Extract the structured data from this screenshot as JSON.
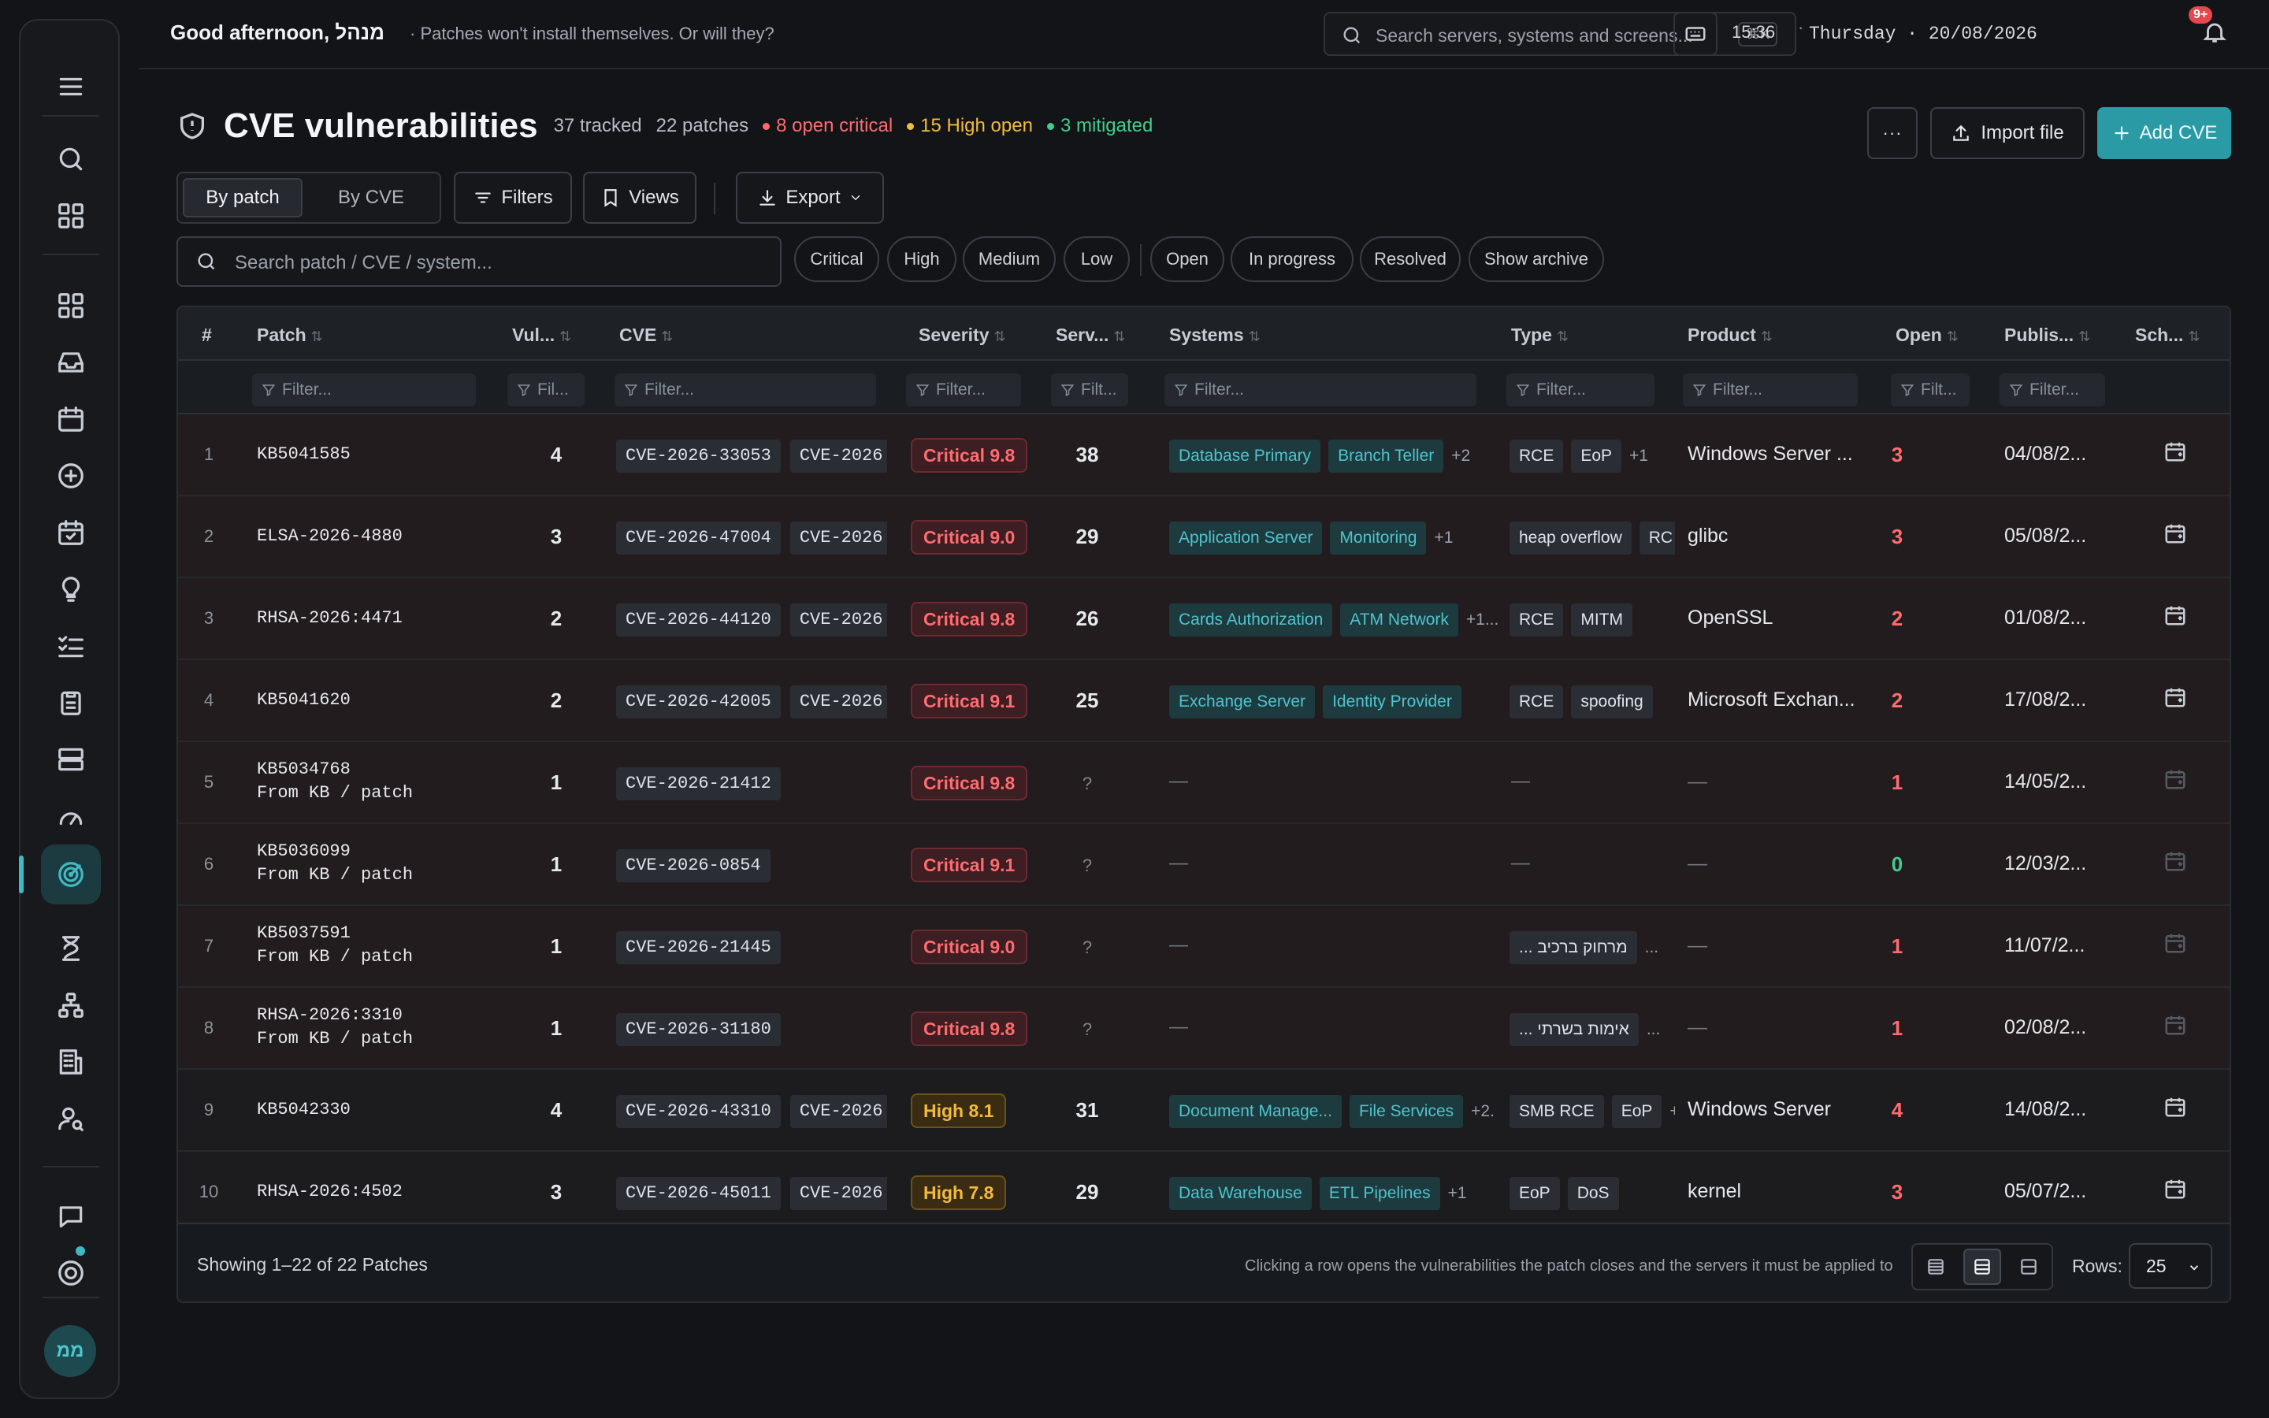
{
  "header": {
    "greeting": "Good afternoon, מנהל",
    "tagline": "· Patches won't install themselves. Or will they?",
    "search_placeholder": "Search servers, systems and screens...",
    "search_shortcut": "⌘K",
    "time": "15:36",
    "time_sep": "·",
    "date": "Thursday · 20/08/2026",
    "notifications_badge": "9+"
  },
  "page": {
    "title": "CVE vulnerabilities",
    "stats": {
      "tracked": "37 tracked",
      "patches": "22 patches",
      "open_critical": "8 open critical",
      "high_open": "15 High open",
      "mitigated": "3 mitigated"
    },
    "actions": {
      "more": "···",
      "import": "Import file",
      "add": "Add CVE"
    }
  },
  "toolbar": {
    "view_by_patch": "By patch",
    "view_by_cve": "By CVE",
    "filters": "Filters",
    "views": "Views",
    "export": "Export",
    "search_placeholder": "Search patch / CVE / system...",
    "chips": [
      "Critical",
      "High",
      "Medium",
      "Low",
      "Open",
      "In progress",
      "Resolved",
      "Show archive"
    ]
  },
  "table": {
    "columns": [
      "#",
      "Patch",
      "Vul...",
      "CVE",
      "Severity",
      "Serv...",
      "Systems",
      "Type",
      "Product",
      "Open",
      "Publis...",
      "Sch..."
    ],
    "filter_placeholders": [
      "Filter...",
      "Fil...",
      "Filter...",
      "Filter...",
      "Filt...",
      "Filter...",
      "Filter...",
      "Filter...",
      "Filt...",
      "Filter..."
    ],
    "rows": [
      {
        "n": "1",
        "patch": "KB5041585",
        "sub": "",
        "vul": "4",
        "cves": [
          "CVE-2026-33053",
          "CVE-2026"
        ],
        "sev": "Critical 9.8",
        "sev_level": "critical",
        "servers": "38",
        "systems": [
          "Database Primary",
          "Branch Teller"
        ],
        "systems_more": "+2",
        "types": [
          "RCE",
          "EoP"
        ],
        "types_more": "+1",
        "product": "Windows Server ...",
        "open": "3",
        "published": "04/08/2...",
        "sched_active": true
      },
      {
        "n": "2",
        "patch": "ELSA-2026-4880",
        "sub": "",
        "vul": "3",
        "cves": [
          "CVE-2026-47004",
          "CVE-2026"
        ],
        "sev": "Critical 9.0",
        "sev_level": "critical",
        "servers": "29",
        "systems": [
          "Application Server",
          "Monitoring"
        ],
        "systems_more": "+1",
        "types": [
          "heap overflow",
          "RC"
        ],
        "types_more": "",
        "product": "glibc",
        "open": "3",
        "published": "05/08/2...",
        "sched_active": true
      },
      {
        "n": "3",
        "patch": "RHSA-2026:4471",
        "sub": "",
        "vul": "2",
        "cves": [
          "CVE-2026-44120",
          "CVE-2026"
        ],
        "sev": "Critical 9.8",
        "sev_level": "critical",
        "servers": "26",
        "systems": [
          "Cards Authorization",
          "ATM Network"
        ],
        "systems_more": "+1...",
        "types": [
          "RCE",
          "MITM"
        ],
        "types_more": "",
        "product": "OpenSSL",
        "open": "2",
        "published": "01/08/2...",
        "sched_active": true
      },
      {
        "n": "4",
        "patch": "KB5041620",
        "sub": "",
        "vul": "2",
        "cves": [
          "CVE-2026-42005",
          "CVE-2026"
        ],
        "sev": "Critical 9.1",
        "sev_level": "critical",
        "servers": "25",
        "systems": [
          "Exchange Server",
          "Identity Provider"
        ],
        "systems_more": "",
        "types": [
          "RCE",
          "spoofing"
        ],
        "types_more": "",
        "product": "Microsoft Exchan...",
        "open": "2",
        "published": "17/08/2...",
        "sched_active": true
      },
      {
        "n": "5",
        "patch": "KB5034768",
        "sub": "From KB / patch",
        "vul": "1",
        "cves": [
          "CVE-2026-21412"
        ],
        "sev": "Critical 9.8",
        "sev_level": "critical",
        "servers": "?",
        "systems": [],
        "systems_more": "",
        "types": [],
        "types_more": "",
        "type_text": "—",
        "product": "—",
        "open": "1",
        "published": "14/05/2...",
        "sched_active": false
      },
      {
        "n": "6",
        "patch": "KB5036099",
        "sub": "From KB / patch",
        "vul": "1",
        "cves": [
          "CVE-2026-0854"
        ],
        "sev": "Critical 9.1",
        "sev_level": "critical",
        "servers": "?",
        "systems": [],
        "systems_more": "",
        "types": [],
        "types_more": "",
        "type_text": "—",
        "product": "—",
        "open": "0",
        "published": "12/03/2...",
        "sched_active": false
      },
      {
        "n": "7",
        "patch": "KB5037591",
        "sub": "From KB / patch",
        "vul": "1",
        "cves": [
          "CVE-2026-21445"
        ],
        "sev": "Critical 9.0",
        "sev_level": "critical",
        "servers": "?",
        "systems": [],
        "systems_more": "",
        "types": [
          "מרחוק ברכיב ..."
        ],
        "types_more": "...",
        "product": "—",
        "open": "1",
        "published": "11/07/2...",
        "sched_active": false
      },
      {
        "n": "8",
        "patch": "RHSA-2026:3310",
        "sub": "From KB / patch",
        "vul": "1",
        "cves": [
          "CVE-2026-31180"
        ],
        "sev": "Critical 9.8",
        "sev_level": "critical",
        "servers": "?",
        "systems": [],
        "systems_more": "",
        "types": [
          "אימות בשרתי ..."
        ],
        "types_more": "...",
        "product": "—",
        "open": "1",
        "published": "02/08/2...",
        "sched_active": false
      },
      {
        "n": "9",
        "patch": "KB5042330",
        "sub": "",
        "vul": "4",
        "cves": [
          "CVE-2026-43310",
          "CVE-2026"
        ],
        "sev": "High 8.1",
        "sev_level": "high",
        "servers": "31",
        "systems": [
          "Document Manage...",
          "File Services"
        ],
        "systems_more": "+2.",
        "types": [
          "SMB RCE",
          "EoP"
        ],
        "types_more": "+",
        "product": "Windows Server",
        "open": "4",
        "published": "14/08/2...",
        "sched_active": true
      },
      {
        "n": "10",
        "patch": "RHSA-2026:4502",
        "sub": "",
        "vul": "3",
        "cves": [
          "CVE-2026-45011",
          "CVE-2026"
        ],
        "sev": "High 7.8",
        "sev_level": "high",
        "servers": "29",
        "systems": [
          "Data Warehouse",
          "ETL Pipelines"
        ],
        "systems_more": "+1",
        "types": [
          "EoP",
          "DoS"
        ],
        "types_more": "",
        "product": "kernel",
        "open": "3",
        "published": "05/07/2...",
        "sched_active": true
      }
    ]
  },
  "footer": {
    "showing": "Showing 1–22 of 22 Patches",
    "hint": "Clicking a row opens the vulnerabilities the patch closes and the servers it must be applied to",
    "rows_label": "Rows:",
    "rows_value": "25"
  },
  "user": {
    "initials": "ממ"
  },
  "colors": {
    "accent": "#2a9aa5",
    "critical": "#ff6b6f",
    "high": "#f3bb3d",
    "mitigated": "#3ecf8e",
    "open_zero": "#3ecf8e"
  }
}
